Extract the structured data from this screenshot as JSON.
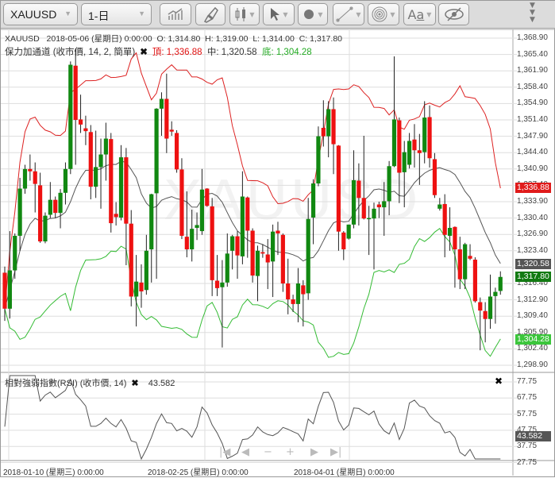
{
  "toolbar": {
    "symbol": "XAUUSD",
    "interval": "1-日",
    "buttons": [
      "indicator-chart-icon",
      "paint-brush-icon",
      "candlestick-icon",
      "cursor-icon",
      "dot-icon",
      "line-tool-icon",
      "concentric-circles-icon",
      "text-icon",
      "eye-slash-icon"
    ],
    "more_icon": "triple-chevron-down-icon"
  },
  "ohlc_legend": {
    "symbol": "XAUUSD",
    "date": "2018-05-06 (星期日) 0:00:00",
    "open": "O: 1,314.80",
    "high": "H: 1,319.00",
    "low": "L: 1,314.00",
    "close": "C: 1,317.80"
  },
  "bollinger_legend": {
    "name": "保力加通道 (收市價, 14, 2, 簡單)",
    "top": "頂: 1,336.88",
    "mid": "中: 1,320.58",
    "bottom": "底: 1,304.28"
  },
  "rsi_legend": {
    "name": "相對強弱指數(RSI) (收市價, 14)",
    "value": "43.582"
  },
  "watermark": "XAUUSD",
  "price_axis": {
    "ticks": [
      "1,368.90",
      "1,365.40",
      "1,361.90",
      "1,358.40",
      "1,354.90",
      "1,351.40",
      "1,347.90",
      "1,344.40",
      "1,340.90",
      "1,337.40",
      "1,333.90",
      "1,330.40",
      "1,326.90",
      "1,323.40",
      "1,319.90",
      "1,316.40",
      "1,312.90",
      "1,309.40",
      "1,305.90",
      "1,302.40",
      "1,298.90"
    ],
    "tags": {
      "top": "1,336.88",
      "mid": "1,320.58",
      "close": "1,317.80",
      "bottom": "1,304.28"
    }
  },
  "rsi_axis": {
    "ticks": [
      "77.75",
      "67.75",
      "57.75",
      "47.75",
      "37.75",
      "27.75"
    ],
    "tag": "43.582"
  },
  "time_axis": [
    "2018-01-10 (星期三) 0:00:00",
    "2018-02-25 (星期日) 0:00:00",
    "2018-04-01 (星期日) 0:00:00"
  ],
  "nav_buttons": [
    "|◀",
    "◀",
    "−",
    "+",
    "▶",
    "▶|"
  ],
  "colors": {
    "up": "#118811",
    "down": "#ee1111",
    "upper_band": "#dd2222",
    "mid_band": "#555555",
    "lower_band": "#33bb33",
    "rsi": "#555555"
  },
  "chart_data": {
    "type": "candlestick",
    "price_range": [
      1298.9,
      1368.9
    ],
    "bollinger": {
      "period": 14,
      "stddev": 2,
      "last": {
        "top": 1336.88,
        "mid": 1320.58,
        "bottom": 1304.28
      }
    },
    "rsi": {
      "period": 14,
      "last": 43.582,
      "range": [
        27.75,
        77.75
      ]
    },
    "candles_ohlc": [
      [
        1318.7,
        1320.0,
        1308.4,
        1311.0
      ],
      [
        1311.0,
        1327.6,
        1308.9,
        1319.2
      ],
      [
        1319.2,
        1327.1,
        1317.4,
        1326.6
      ],
      [
        1326.6,
        1339.0,
        1323.4,
        1336.7
      ],
      [
        1336.7,
        1341.8,
        1335.6,
        1340.9
      ],
      [
        1340.9,
        1344.0,
        1338.4,
        1340.4
      ],
      [
        1340.4,
        1342.3,
        1331.6,
        1337.7
      ],
      [
        1337.4,
        1340.1,
        1325.1,
        1325.4
      ],
      [
        1325.4,
        1331.6,
        1325.0,
        1330.9
      ],
      [
        1331.1,
        1338.1,
        1330.4,
        1334.3
      ],
      [
        1334.3,
        1335.0,
        1330.4,
        1331.5
      ],
      [
        1331.5,
        1336.6,
        1328.2,
        1335.8
      ],
      [
        1335.8,
        1342.3,
        1333.3,
        1340.9
      ],
      [
        1340.9,
        1363.9,
        1339.8,
        1363.2
      ],
      [
        1363.0,
        1366.7,
        1341.8,
        1351.4
      ],
      [
        1351.5,
        1356.8,
        1348.6,
        1350.4
      ],
      [
        1349.6,
        1352.3,
        1346.0,
        1349.0
      ],
      [
        1348.8,
        1350.3,
        1334.4,
        1337.1
      ],
      [
        1337.1,
        1349.1,
        1334.7,
        1341.3
      ],
      [
        1341.3,
        1347.4,
        1332.4,
        1344.0
      ],
      [
        1344.0,
        1350.8,
        1338.4,
        1347.4
      ],
      [
        1347.3,
        1348.6,
        1327.3,
        1329.3
      ],
      [
        1331.3,
        1333.8,
        1328.8,
        1330.6
      ],
      [
        1330.5,
        1346.0,
        1329.9,
        1343.4
      ],
      [
        1343.4,
        1345.4,
        1320.3,
        1329.2
      ],
      [
        1329.2,
        1332.1,
        1311.5,
        1313.6
      ],
      [
        1313.6,
        1322.5,
        1307.2,
        1316.8
      ],
      [
        1316.6,
        1320.5,
        1311.2,
        1314.7
      ],
      [
        1315.0,
        1326.8,
        1314.0,
        1323.4
      ],
      [
        1323.7,
        1335.6,
        1316.6,
        1335.5
      ],
      [
        1335.7,
        1353.9,
        1317.4,
        1353.8
      ],
      [
        1353.8,
        1357.3,
        1348.0,
        1355.9
      ],
      [
        1355.9,
        1361.3,
        1344.3,
        1347.4
      ],
      [
        1349.3,
        1351.1,
        1348.0,
        1348.9
      ],
      [
        1348.6,
        1349.2,
        1340.1,
        1340.8
      ],
      [
        1340.8,
        1343.2,
        1325.9,
        1326.6
      ],
      [
        1326.4,
        1336.1,
        1322.0,
        1323.7
      ],
      [
        1323.7,
        1332.2,
        1321.1,
        1328.1
      ],
      [
        1328.3,
        1331.6,
        1325.7,
        1328.9
      ],
      [
        1327.6,
        1340.9,
        1326.8,
        1336.5
      ],
      [
        1336.7,
        1336.8,
        1332.8,
        1333.0
      ],
      [
        1332.9,
        1334.7,
        1313.7,
        1317.1
      ],
      [
        1317.0,
        1322.5,
        1313.7,
        1315.4
      ],
      [
        1315.6,
        1321.4,
        1302.7,
        1316.6
      ],
      [
        1316.6,
        1327.1,
        1315.7,
        1322.8
      ],
      [
        1323.4,
        1326.8,
        1319.4,
        1326.5
      ],
      [
        1326.5,
        1327.6,
        1317.4,
        1322.4
      ],
      [
        1322.2,
        1340.4,
        1320.5,
        1335.0
      ],
      [
        1334.8,
        1335.0,
        1321.9,
        1327.7
      ],
      [
        1327.7,
        1328.2,
        1316.6,
        1318.1
      ],
      [
        1318.0,
        1324.5,
        1312.6,
        1323.4
      ],
      [
        1323.1,
        1324.8,
        1321.9,
        1322.8
      ],
      [
        1322.6,
        1325.9,
        1315.2,
        1320.9
      ],
      [
        1321.1,
        1329.0,
        1313.5,
        1327.5
      ],
      [
        1327.7,
        1329.6,
        1322.5,
        1327.1
      ],
      [
        1326.8,
        1327.1,
        1314.6,
        1316.4
      ],
      [
        1316.4,
        1321.7,
        1309.8,
        1313.0
      ],
      [
        1313.0,
        1314.0,
        1310.3,
        1312.0
      ],
      [
        1312.0,
        1319.7,
        1308.1,
        1316.4
      ],
      [
        1316.0,
        1317.1,
        1307.2,
        1314.1
      ],
      [
        1314.3,
        1334.7,
        1312.9,
        1330.2
      ],
      [
        1330.5,
        1338.7,
        1324.8,
        1337.8
      ],
      [
        1337.8,
        1350.0,
        1337.2,
        1347.9
      ],
      [
        1349.7,
        1355.6,
        1345.7,
        1347.9
      ],
      [
        1347.9,
        1355.4,
        1343.4,
        1353.7
      ],
      [
        1353.7,
        1356.2,
        1339.8,
        1346.2
      ],
      [
        1345.9,
        1346.0,
        1323.4,
        1327.5
      ],
      [
        1327.3,
        1327.6,
        1321.4,
        1323.7
      ],
      [
        1326.0,
        1329.0,
        1325.8,
        1329.0
      ],
      [
        1329.0,
        1344.9,
        1328.2,
        1338.5
      ],
      [
        1338.4,
        1342.1,
        1328.8,
        1334.7
      ],
      [
        1334.7,
        1348.0,
        1330.1,
        1330.3
      ],
      [
        1330.3,
        1333.0,
        1322.5,
        1330.4
      ],
      [
        1330.3,
        1333.7,
        1319.4,
        1332.4
      ],
      [
        1333.3,
        1333.9,
        1330.4,
        1332.7
      ],
      [
        1332.7,
        1338.1,
        1326.6,
        1334.0
      ],
      [
        1334.0,
        1342.6,
        1331.0,
        1341.5
      ],
      [
        1341.5,
        1365.0,
        1341.3,
        1351.5
      ],
      [
        1351.3,
        1351.9,
        1333.6,
        1340.1
      ],
      [
        1340.2,
        1346.9,
        1332.7,
        1344.5
      ],
      [
        1341.8,
        1348.6,
        1341.0,
        1346.9
      ],
      [
        1347.2,
        1350.5,
        1341.2,
        1344.9
      ],
      [
        1344.9,
        1348.4,
        1337.5,
        1344.3
      ],
      [
        1344.5,
        1355.4,
        1342.1,
        1351.9
      ],
      [
        1352.0,
        1354.5,
        1341.2,
        1343.2
      ],
      [
        1343.0,
        1344.3,
        1334.7,
        1335.3
      ],
      [
        1332.4,
        1334.7,
        1332.0,
        1333.3
      ],
      [
        1333.4,
        1335.5,
        1322.0,
        1326.8
      ],
      [
        1326.6,
        1332.7,
        1323.4,
        1328.3
      ],
      [
        1328.5,
        1328.6,
        1315.5,
        1323.7
      ],
      [
        1323.7,
        1326.4,
        1315.2,
        1317.3
      ],
      [
        1317.3,
        1325.1,
        1315.2,
        1324.8
      ],
      [
        1322.3,
        1324.8,
        1321.4,
        1321.7
      ],
      [
        1321.5,
        1322.0,
        1312.3,
        1312.6
      ],
      [
        1312.4,
        1313.4,
        1302.1,
        1310.6
      ],
      [
        1310.5,
        1312.4,
        1303.8,
        1308.8
      ],
      [
        1308.8,
        1318.3,
        1306.7,
        1313.6
      ],
      [
        1313.7,
        1315.5,
        1307.8,
        1314.6
      ],
      [
        1314.8,
        1319.0,
        1314.0,
        1317.8
      ]
    ]
  }
}
